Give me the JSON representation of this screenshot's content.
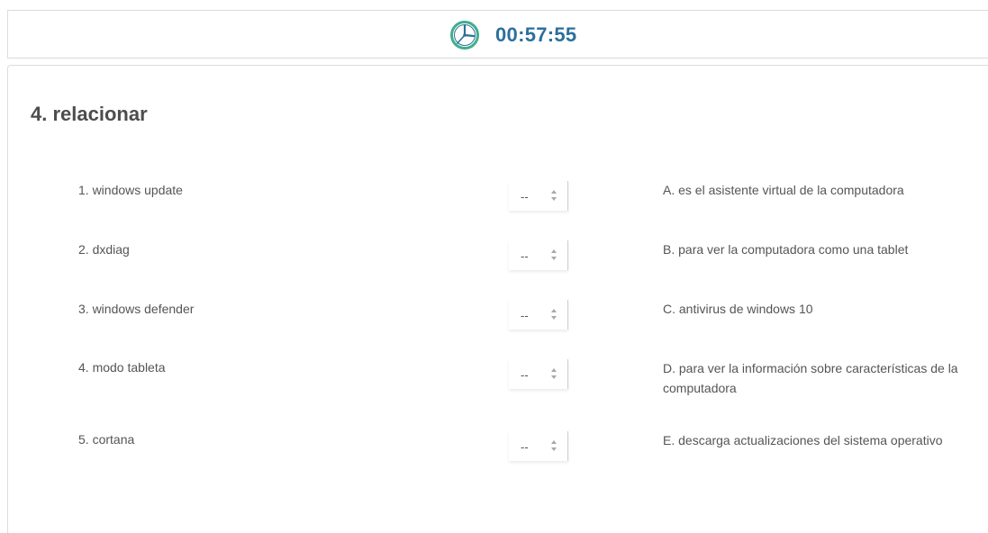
{
  "timer": {
    "time": "00:57:55",
    "icon": "clock-icon"
  },
  "question": {
    "title": "4. relacionar"
  },
  "left_items": [
    {
      "label": "1. windows update",
      "selected": "--"
    },
    {
      "label": "2. dxdiag",
      "selected": "--"
    },
    {
      "label": "3. windows defender",
      "selected": "--"
    },
    {
      "label": "4. modo tableta",
      "selected": "--"
    },
    {
      "label": "5. cortana",
      "selected": "--"
    }
  ],
  "right_items": [
    {
      "label": "A.  es el asistente virtual de la computadora"
    },
    {
      "label": "B.  para ver la computadora como una tablet"
    },
    {
      "label": "C.  antivirus de windows 10"
    },
    {
      "label": "D.  para ver la información sobre características de la computadora"
    },
    {
      "label": "E.  descarga actualizaciones del sistema operativo"
    }
  ],
  "colors": {
    "accent": "#2d6f9c",
    "clock_ring": "#3fae8c"
  }
}
